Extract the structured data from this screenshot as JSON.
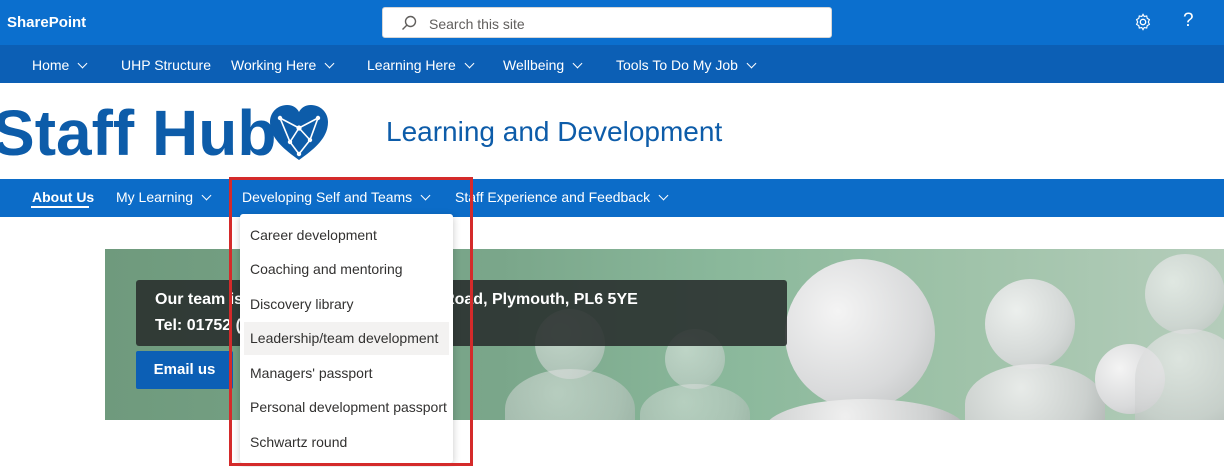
{
  "suitebar": {
    "brand": "SharePoint",
    "search_placeholder": "Search this site",
    "settings_icon": "gear-icon",
    "help_label": "?"
  },
  "hub_nav": {
    "items": [
      {
        "label": "Home",
        "has_menu": true
      },
      {
        "label": "UHP Structure",
        "has_menu": false
      },
      {
        "label": "Working Here",
        "has_menu": true
      },
      {
        "label": "Learning Here",
        "has_menu": true
      },
      {
        "label": "Wellbeing",
        "has_menu": true
      },
      {
        "label": "Tools To Do My Job",
        "has_menu": true
      }
    ]
  },
  "header": {
    "logo_text": "Staff Hub",
    "logo_icon": "heart-network-icon",
    "site_title": "Learning and Development"
  },
  "site_nav": {
    "items": [
      {
        "label": "About Us",
        "active": true,
        "has_menu": false
      },
      {
        "label": "My Learning",
        "active": false,
        "has_menu": true
      },
      {
        "label": "Developing Self and Teams",
        "active": false,
        "has_menu": true
      },
      {
        "label": "Staff Experience and Feedback",
        "active": false,
        "has_menu": true
      }
    ]
  },
  "dropdown": {
    "items": [
      "Career development",
      "Coaching and mentoring",
      "Discovery library",
      "Leadership/team development",
      "Managers' passport",
      "Personal development passport",
      "Schwartz round"
    ],
    "hovered": "Leadership/team development"
  },
  "hero": {
    "line1": "Our team is based at 2nd Floor, Brest Road, Plymouth, PL6 5YE",
    "line2": "Tel: 01752 (Monday–Friday 9am–5pm)",
    "button_label": "Email us"
  },
  "colors": {
    "suitebar": "#0b6fce",
    "hubnav": "#0c5fb5",
    "sitenav": "#0c6cc8",
    "brand_blue": "#0d5ca9",
    "highlight": "#d42a2a"
  }
}
